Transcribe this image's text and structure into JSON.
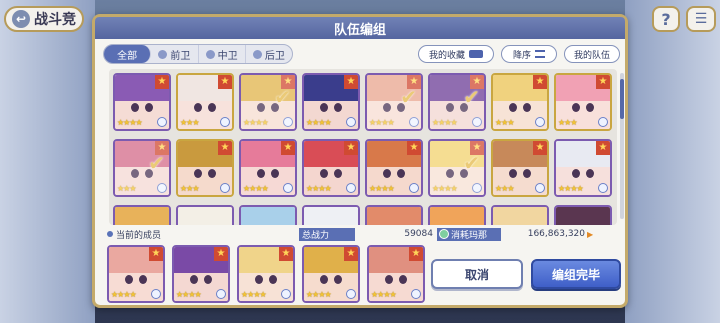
{
  "top": {
    "back_label": "战斗竞",
    "back_arrow": "↩",
    "help_label": "?",
    "menu_label": "☰"
  },
  "dialog": {
    "title": "队伍编组"
  },
  "filters": [
    {
      "label": "全部",
      "active": true
    },
    {
      "label": "前卫",
      "active": false
    },
    {
      "label": "中卫",
      "active": false
    },
    {
      "label": "后卫",
      "active": false
    }
  ],
  "pills": {
    "favorites": "我的收藏",
    "sort": "降序",
    "my_team": "我的队伍"
  },
  "status": {
    "members_label": "当前的成员",
    "power_label": "总战力",
    "power_value": "59084",
    "mana_label": "消耗玛那",
    "mana_value": "166,863,320",
    "mana_arrow": "▶"
  },
  "buttons": {
    "cancel": "取消",
    "done": "编组完毕"
  },
  "characters_row1": [
    {
      "hair": "#8a5bb4",
      "skin": "#f5dcd5",
      "stars": "★★★★",
      "checked": false,
      "gold": false
    },
    {
      "hair": "#f0e6e2",
      "skin": "#f7e2dc",
      "stars": "★★★",
      "checked": false,
      "gold": true
    },
    {
      "hair": "#e0b34a",
      "skin": "#f6dccf",
      "stars": "★★★★",
      "checked": true,
      "gold": false
    },
    {
      "hair": "#3a3d8c",
      "skin": "#f3d8d1",
      "stars": "★★★★",
      "checked": false,
      "gold": false
    },
    {
      "hair": "#e8a48e",
      "skin": "#f7dcd2",
      "stars": "★★★★",
      "checked": true,
      "gold": false
    },
    {
      "hair": "#6b3d96",
      "skin": "#f2d6d0",
      "stars": "★★★★",
      "checked": true,
      "gold": false
    },
    {
      "hair": "#f0d27e",
      "skin": "#f7e3d6",
      "stars": "★★★",
      "checked": false,
      "gold": true
    },
    {
      "hair": "#f1a1b4",
      "skin": "#f8e0db",
      "stars": "★★★",
      "checked": false,
      "gold": true
    }
  ],
  "characters_row2": [
    {
      "hair": "#d36a88",
      "skin": "#f5d9d3",
      "stars": "★★★",
      "checked": true,
      "gold": false
    },
    {
      "hair": "#c99a3e",
      "skin": "#f5dacc",
      "stars": "★★★",
      "checked": false,
      "gold": true
    },
    {
      "hair": "#e67b9a",
      "skin": "#f6d9d5",
      "stars": "★★★★",
      "checked": false,
      "gold": false
    },
    {
      "hair": "#d94d56",
      "skin": "#f4d6cf",
      "stars": "★★★★",
      "checked": false,
      "gold": false
    },
    {
      "hair": "#d8794a",
      "skin": "#f5d9cd",
      "stars": "★★★★",
      "checked": false,
      "gold": false
    },
    {
      "hair": "#f2d26e",
      "skin": "#f7e0d3",
      "stars": "★★★★",
      "checked": true,
      "gold": false
    },
    {
      "hair": "#c7895a",
      "skin": "#f5dccf",
      "stars": "★★★",
      "checked": false,
      "gold": true
    },
    {
      "hair": "#e8eaf2",
      "skin": "#f6e0dc",
      "stars": "★★★★",
      "checked": false,
      "gold": false
    }
  ],
  "characters_row3": [
    {
      "hair": "#e8b25a"
    },
    {
      "hair": "#f3efe6"
    },
    {
      "hair": "#a9d0ea"
    },
    {
      "hair": "#eef0f4"
    },
    {
      "hair": "#e28b6a"
    },
    {
      "hair": "#f0a45a"
    },
    {
      "hair": "#f1d6a0"
    },
    {
      "hair": "#5a3650"
    }
  ],
  "team": [
    {
      "hair": "#eaa8a0",
      "skin": "#f7dcd4",
      "stars": "★★★★"
    },
    {
      "hair": "#7a4aa6",
      "skin": "#f4d8d2",
      "stars": "★★★★"
    },
    {
      "hair": "#f0d48a",
      "skin": "#f7e2d6",
      "stars": "★★★★"
    },
    {
      "hair": "#e0b04a",
      "skin": "#f6dcce",
      "stars": "★★★★"
    },
    {
      "hair": "#e09080",
      "skin": "#f6dad2",
      "stars": "★★★★"
    }
  ]
}
